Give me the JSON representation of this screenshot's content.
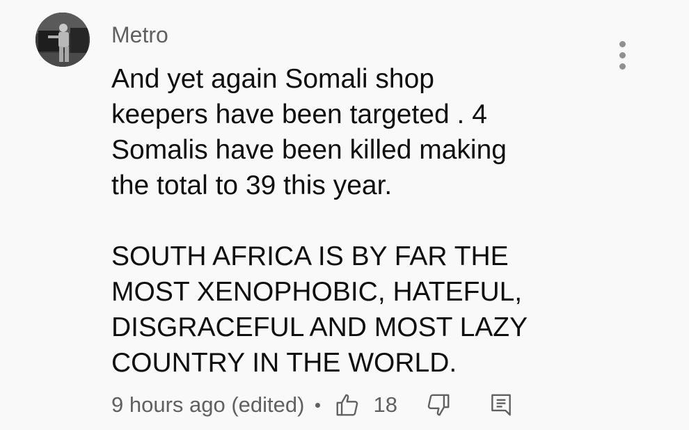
{
  "comment": {
    "author": "Metro",
    "paragraphs": [
      "And yet again Somali shop\nkeepers have been targeted . 4\nSomalis have been killed making\nthe total to 39 this year.",
      "SOUTH AFRICA IS BY FAR THE\nMOST XENOPHOBIC, HATEFUL,\nDISGRACEFUL AND MOST LAZY\nCOUNTRY IN THE WORLD."
    ],
    "timestamp": "9 hours ago (edited)",
    "like_count": "18"
  },
  "icons": {
    "menu": "more-vertical-icon",
    "like": "thumbs-up-icon",
    "dislike": "thumbs-down-icon",
    "reply": "reply-icon"
  },
  "colors": {
    "background": "#f9f9f9",
    "text": "#0f0f0f",
    "secondary_text": "#606060",
    "icon": "#909090"
  }
}
